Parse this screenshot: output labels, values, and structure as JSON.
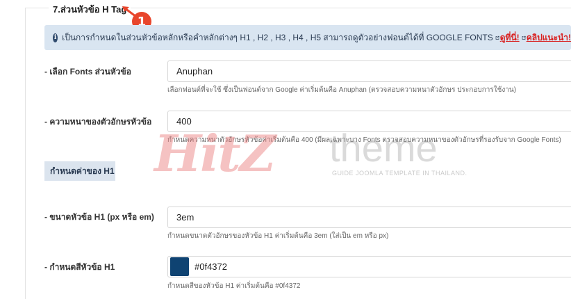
{
  "section": {
    "title": "7.ส่วนหัวข้อ H Tag",
    "annotation_number": "1"
  },
  "info": {
    "text": "เป็นการกำหนดในส่วนหัวข้อหลักหรือคำหลักต่างๆ H1 , H2 , H3 , H4 , H5 สามารถดูตัวอย่างฟอนต์ได้ที่ GOOGLE FONTS",
    "link1": "ดูที่นี่!",
    "link2": "คลิปแนะนำ!",
    "link_color": "#d92020",
    "background": "#d9e5f1"
  },
  "fields": {
    "font": {
      "label": "- เลือก Fonts ส่วนหัวข้อ",
      "value": "Anuphan",
      "help": "เลือกฟอนต์ที่จะใช้ ซึ่งเป็นฟอนต์จาก Google ค่าเริ่มต้นคือ Anuphan (ตรวจสอบความหนาตัวอักษร ประกอบการใช้งาน)"
    },
    "weight": {
      "label": "- ความหนาของตัวอักษรหัวข้อ",
      "value": "400",
      "help": "กำหนดความหนาตัวอักษรหัวข้อค่าเริ่มต้นคือ 400 (มีผลเฉพาะบาง Fonts ตรวจสอบความหนาของตัวอักษรที่รองรับจาก Google Fonts)"
    },
    "h1_section": {
      "label": "กำหนดค่าของ H1"
    },
    "h1_size": {
      "label": "- ขนาดหัวข้อ H1 (px หรือ em)",
      "value": "3em",
      "help": "กำหนดขนาดตัวอักษรของหัวข้อ H1 ค่าเริ่มต้นคือ 3em (ใส่เป็น em หรือ px)"
    },
    "h1_color": {
      "label": "- กำหนดสีหัวข้อ H1",
      "value": "#0f4372",
      "swatch": "#0f4372",
      "help": "กำหนดสีของหัวข้อ H1 ค่าเริ่มต้นคือ #0f4372"
    }
  },
  "watermark": {
    "brand": "HitZ",
    "word": "theme",
    "tagline": "GUIDE JOOMLA TEMPLATE IN THAILAND."
  },
  "colors": {
    "annotation_badge": "#e8462c",
    "info_icon": "#2f4a6d"
  }
}
